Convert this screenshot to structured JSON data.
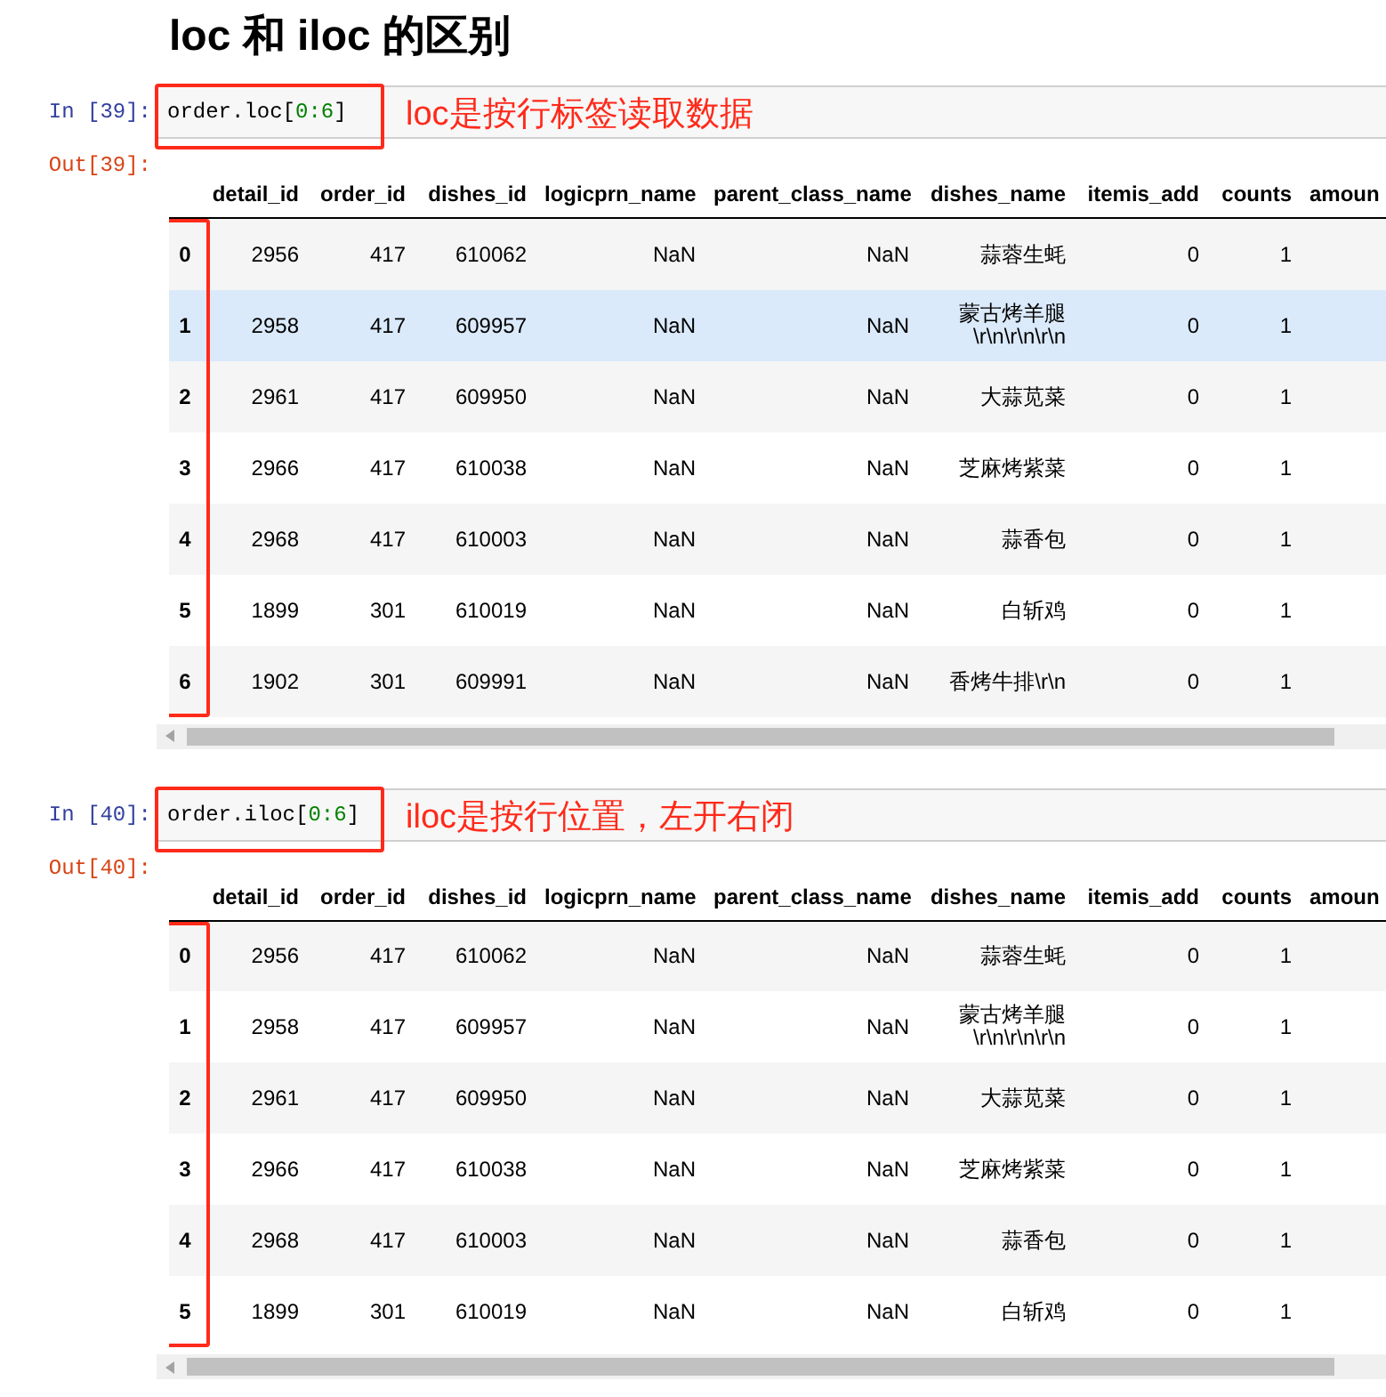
{
  "heading": "loc 和 iloc 的区别",
  "cells": [
    {
      "in_prompt": "In  [39]:",
      "code": [
        {
          "kind": "plain",
          "text": "order.loc["
        },
        {
          "kind": "number",
          "text": "0:6"
        },
        {
          "kind": "plain",
          "text": "]"
        }
      ],
      "note": "loc是按行标签读取数据",
      "out_prompt": "Out[39]:",
      "table": {
        "columns": [
          "detail_id",
          "order_id",
          "dishes_id",
          "logicprn_name",
          "parent_class_name",
          "dishes_name",
          "itemis_add",
          "counts",
          "amoun"
        ],
        "rows": [
          {
            "index": "0",
            "highlighted": false,
            "cells": [
              "2956",
              "417",
              "610062",
              "NaN",
              "NaN",
              "蒜蓉生蚝",
              "0",
              "1"
            ]
          },
          {
            "index": "1",
            "highlighted": true,
            "cells": [
              "2958",
              "417",
              "609957",
              "NaN",
              "NaN",
              "蒙古烤羊腿\\r\\n\\r\\n\\r\\n",
              "0",
              "1"
            ]
          },
          {
            "index": "2",
            "highlighted": false,
            "cells": [
              "2961",
              "417",
              "609950",
              "NaN",
              "NaN",
              "大蒜苋菜",
              "0",
              "1"
            ]
          },
          {
            "index": "3",
            "highlighted": false,
            "cells": [
              "2966",
              "417",
              "610038",
              "NaN",
              "NaN",
              "芝麻烤紫菜",
              "0",
              "1"
            ]
          },
          {
            "index": "4",
            "highlighted": false,
            "cells": [
              "2968",
              "417",
              "610003",
              "NaN",
              "NaN",
              "蒜香包",
              "0",
              "1"
            ]
          },
          {
            "index": "5",
            "highlighted": false,
            "cells": [
              "1899",
              "301",
              "610019",
              "NaN",
              "NaN",
              "白斩鸡",
              "0",
              "1"
            ]
          },
          {
            "index": "6",
            "highlighted": false,
            "cells": [
              "1902",
              "301",
              "609991",
              "NaN",
              "NaN",
              "香烤牛排\\r\\n",
              "0",
              "1"
            ]
          }
        ]
      }
    },
    {
      "in_prompt": "In  [40]:",
      "code": [
        {
          "kind": "plain",
          "text": "order.iloc["
        },
        {
          "kind": "number",
          "text": "0:6"
        },
        {
          "kind": "plain",
          "text": "]"
        }
      ],
      "note": "iloc是按行位置，左开右闭",
      "out_prompt": "Out[40]:",
      "table": {
        "columns": [
          "detail_id",
          "order_id",
          "dishes_id",
          "logicprn_name",
          "parent_class_name",
          "dishes_name",
          "itemis_add",
          "counts",
          "amoun"
        ],
        "rows": [
          {
            "index": "0",
            "highlighted": false,
            "cells": [
              "2956",
              "417",
              "610062",
              "NaN",
              "NaN",
              "蒜蓉生蚝",
              "0",
              "1"
            ]
          },
          {
            "index": "1",
            "highlighted": false,
            "cells": [
              "2958",
              "417",
              "609957",
              "NaN",
              "NaN",
              "蒙古烤羊腿\\r\\n\\r\\n\\r\\n",
              "0",
              "1"
            ]
          },
          {
            "index": "2",
            "highlighted": false,
            "cells": [
              "2961",
              "417",
              "609950",
              "NaN",
              "NaN",
              "大蒜苋菜",
              "0",
              "1"
            ]
          },
          {
            "index": "3",
            "highlighted": false,
            "cells": [
              "2966",
              "417",
              "610038",
              "NaN",
              "NaN",
              "芝麻烤紫菜",
              "0",
              "1"
            ]
          },
          {
            "index": "4",
            "highlighted": false,
            "cells": [
              "2968",
              "417",
              "610003",
              "NaN",
              "NaN",
              "蒜香包",
              "0",
              "1"
            ]
          },
          {
            "index": "5",
            "highlighted": false,
            "cells": [
              "1899",
              "301",
              "610019",
              "NaN",
              "NaN",
              "白斩鸡",
              "0",
              "1"
            ]
          }
        ]
      }
    }
  ]
}
